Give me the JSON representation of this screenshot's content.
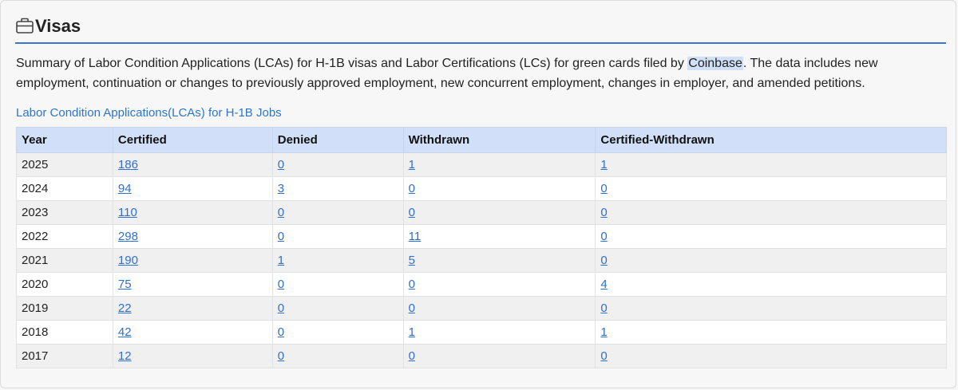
{
  "section": {
    "title": "Visas",
    "icon": "briefcase-icon"
  },
  "summary": {
    "before": "Summary of Labor Condition Applications (LCAs) for H-1B visas and Labor Certifications (LCs) for green cards filed by ",
    "company": "Coinbase",
    "after": ". The data includes new employment, continuation or changes to previously approved employment, new concurrent employment, changes in employer, and amended petitions."
  },
  "lca_link": "Labor Condition Applications(LCAs) for H-1B Jobs",
  "table": {
    "headers": [
      "Year",
      "Certified",
      "Denied",
      "Withdrawn",
      "Certified-Withdrawn"
    ],
    "rows": [
      [
        "2025",
        "186",
        "0",
        "1",
        "1"
      ],
      [
        "2024",
        "94",
        "3",
        "0",
        "0"
      ],
      [
        "2023",
        "110",
        "0",
        "0",
        "0"
      ],
      [
        "2022",
        "298",
        "0",
        "11",
        "0"
      ],
      [
        "2021",
        "190",
        "1",
        "5",
        "0"
      ],
      [
        "2020",
        "75",
        "0",
        "0",
        "4"
      ],
      [
        "2019",
        "22",
        "0",
        "0",
        "0"
      ],
      [
        "2018",
        "42",
        "0",
        "1",
        "1"
      ],
      [
        "2017",
        "12",
        "0",
        "0",
        "0"
      ]
    ]
  },
  "colors": {
    "accent": "#3b73d6",
    "link": "#2f6fd1",
    "header_bg": "#d1e0f8",
    "highlight": "#cfe0f7"
  }
}
